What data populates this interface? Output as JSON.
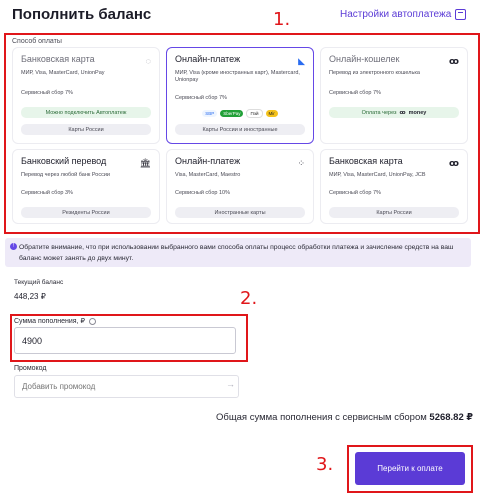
{
  "header": {
    "title": "Пополнить баланс",
    "autopay_link": "Настройки автоплатежа",
    "autopay_icon": "calendar-icon"
  },
  "annotations": {
    "n1": "1.",
    "n2": "2.",
    "n3": "3.",
    "color": "#e0161a"
  },
  "methods": {
    "label": "Способ оплаты",
    "cards": [
      {
        "title": "Банковская карта",
        "sub": "МИР, Visa, MasterCard, UnionPay",
        "fee": "Сервисный сбор 7%",
        "pill_green": "Можно подключить Автоплатеж",
        "pill": "Карты России",
        "icon": "circle-icon"
      },
      {
        "title": "Онлайн-платеж",
        "sub": "МИР, Visa (кроме иностранных карт), Mastercard, Unionpay",
        "fee": "Сервисный сбор 7%",
        "logos": [
          "SberPay",
          "SBP",
          "Пэй",
          "Mir"
        ],
        "pill": "Карты России и иностранные",
        "icon": "kassa-icon"
      },
      {
        "title": "Онлайн-кошелек",
        "sub": "Перевод из электронного кошелька",
        "fee": "Сервисный сбор 7%",
        "pill_green_prefix": "Оплата через",
        "pill_green_brand": "money",
        "icon": "yoomoney-icon"
      },
      {
        "title": "Банковский перевод",
        "sub": "Перевод через любой банк России",
        "fee": "Сервисный сбор 3%",
        "pill": "Резиденты России",
        "icon": "bank-icon"
      },
      {
        "title": "Онлайн-платеж",
        "sub": "Visa, MasterCard, Maestro",
        "fee": "Сервисный сбор 10%",
        "pill": "Иностранные карты",
        "icon": "apps-icon"
      },
      {
        "title": "Банковская карта",
        "sub": "МИР, Visa, MasterCard, UnionPay, JCB",
        "fee": "Сервисный сбор 7%",
        "pill": "Карты России",
        "icon": "yoomoney-icon"
      }
    ]
  },
  "notice": {
    "text": "Обратите внимание, что при использовании выбранного вами способа оплаты процесс обработки платежа и зачисление средств на ваш баланс может занять до двух минут."
  },
  "balance": {
    "label": "Текущий баланс",
    "value": "448,23 ₽"
  },
  "amount": {
    "label": "Сумма пополнения, ₽",
    "value": "4900"
  },
  "promo": {
    "label": "Промокод",
    "placeholder": "Добавить промокод"
  },
  "total": {
    "text": "Общая сумма пополнения с сервисным сбором",
    "value": "5268.82 ₽"
  },
  "pay_button": {
    "label": "Перейти к оплате"
  }
}
